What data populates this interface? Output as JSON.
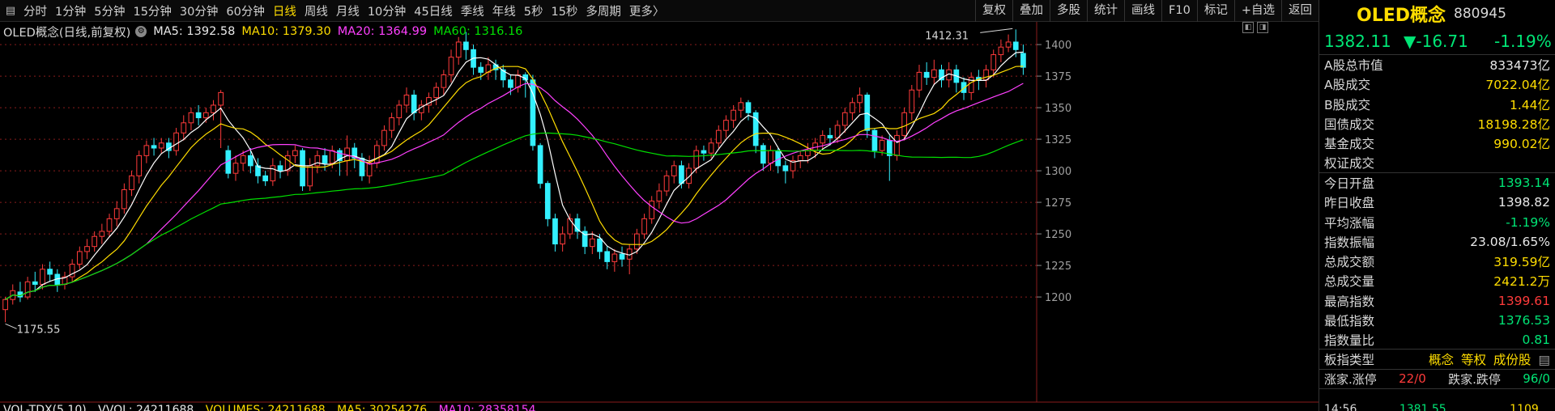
{
  "toolbar": {
    "periods": [
      "分时",
      "1分钟",
      "5分钟",
      "15分钟",
      "30分钟",
      "60分钟",
      "日线",
      "周线",
      "月线",
      "10分钟",
      "45日线",
      "季线",
      "年线",
      "5秒",
      "15秒",
      "多周期",
      "更多〉"
    ],
    "active_period": "日线",
    "tools": [
      "复权",
      "叠加",
      "多股",
      "统计",
      "画线",
      "F10",
      "标记",
      "+自选",
      "返回"
    ]
  },
  "legend": {
    "title": "OLED概念(日线,前复权)",
    "ma5": "MA5: 1392.58",
    "ma10": "MA10: 1379.30",
    "ma20": "MA20: 1364.99",
    "ma60": "MA60: 1316.16"
  },
  "colors": {
    "up": "#ff3b3b",
    "down": "#33f0ff",
    "ma5": "#ffffff",
    "ma10": "#ffdd00",
    "ma20": "#ff40ff",
    "ma60": "#00e000",
    "grid": "#8a1c1c"
  },
  "annotations": {
    "high_label": "1412.31",
    "low_label": "1175.55"
  },
  "volume_legend": {
    "label": "VOL-TDX(5,10)",
    "vvol": "VVOL: 24211688",
    "volumes": "VOLUMES: 24211688",
    "ma5": "MA5: 30254276",
    "ma10": "MA10: 28358154"
  },
  "panel": {
    "name": "OLED概念",
    "code": "880945",
    "price": "1382.11",
    "change": "▼-16.71",
    "change_pct": "-1.19%",
    "rows": [
      {
        "label": "A股总市值",
        "value": "833473亿",
        "color": "wht"
      },
      {
        "label": "A股成交",
        "value": "7022.04亿",
        "color": "yel"
      },
      {
        "label": "B股成交",
        "value": "1.44亿",
        "color": "yel"
      },
      {
        "label": "国债成交",
        "value": "18198.28亿",
        "color": "yel"
      },
      {
        "label": "基金成交",
        "value": "990.02亿",
        "color": "yel"
      },
      {
        "label": "权证成交",
        "value": "",
        "color": "yel"
      },
      {
        "label": "今日开盘",
        "value": "1393.14",
        "color": "grn"
      },
      {
        "label": "昨日收盘",
        "value": "1398.82",
        "color": "wht"
      },
      {
        "label": "平均涨幅",
        "value": "-1.19%",
        "color": "grn"
      },
      {
        "label": "指数振幅",
        "value": "23.08/1.65%",
        "color": "wht"
      },
      {
        "label": "总成交额",
        "value": "319.59亿",
        "color": "yel"
      },
      {
        "label": "总成交量",
        "value": "2421.2万",
        "color": "yel"
      },
      {
        "label": "最高指数",
        "value": "1399.61",
        "color": "red"
      },
      {
        "label": "最低指数",
        "value": "1376.53",
        "color": "grn"
      },
      {
        "label": "指数量比",
        "value": "0.81",
        "color": "grn"
      }
    ],
    "type_label": "板指类型",
    "type_values": [
      "概念",
      "等权",
      "成份股"
    ],
    "zd": {
      "up_label": "涨家.涨停",
      "up_value": "22/0",
      "down_label": "跌家.跌停",
      "down_value": "96/0"
    },
    "last_row": [
      "14:56",
      "1381.55",
      "1109"
    ]
  },
  "chart_data": {
    "type": "candlestick",
    "y_ticks": [
      1200,
      1225,
      1250,
      1275,
      1300,
      1325,
      1350,
      1375,
      1400
    ],
    "ylim": [
      1168,
      1418
    ],
    "grid": "horizontal dashed",
    "series": [
      {
        "name": "MA5"
      },
      {
        "name": "MA10"
      },
      {
        "name": "MA20"
      },
      {
        "name": "MA60"
      }
    ],
    "candles": [
      [
        1190,
        1198,
        1180,
        1200
      ],
      [
        1198,
        1205,
        1194,
        1210
      ],
      [
        1204,
        1200,
        1196,
        1212
      ],
      [
        1200,
        1212,
        1198,
        1216
      ],
      [
        1212,
        1210,
        1204,
        1220
      ],
      [
        1210,
        1222,
        1206,
        1226
      ],
      [
        1222,
        1218,
        1212,
        1228
      ],
      [
        1218,
        1210,
        1204,
        1222
      ],
      [
        1210,
        1216,
        1206,
        1220
      ],
      [
        1216,
        1226,
        1212,
        1230
      ],
      [
        1226,
        1236,
        1222,
        1240
      ],
      [
        1236,
        1240,
        1230,
        1246
      ],
      [
        1240,
        1248,
        1236,
        1252
      ],
      [
        1248,
        1252,
        1242,
        1258
      ],
      [
        1252,
        1262,
        1248,
        1266
      ],
      [
        1262,
        1270,
        1256,
        1276
      ],
      [
        1270,
        1285,
        1266,
        1290
      ],
      [
        1285,
        1296,
        1280,
        1300
      ],
      [
        1296,
        1312,
        1290,
        1316
      ],
      [
        1312,
        1320,
        1306,
        1324
      ],
      [
        1320,
        1318,
        1312,
        1326
      ],
      [
        1318,
        1322,
        1314,
        1326
      ],
      [
        1322,
        1316,
        1310,
        1326
      ],
      [
        1316,
        1330,
        1312,
        1334
      ],
      [
        1330,
        1338,
        1324,
        1344
      ],
      [
        1338,
        1346,
        1332,
        1350
      ],
      [
        1346,
        1342,
        1336,
        1352
      ],
      [
        1342,
        1346,
        1338,
        1350
      ],
      [
        1346,
        1352,
        1340,
        1356
      ],
      [
        1352,
        1362,
        1318,
        1364
      ],
      [
        1316,
        1298,
        1294,
        1320
      ],
      [
        1298,
        1306,
        1292,
        1312
      ],
      [
        1306,
        1312,
        1300,
        1316
      ],
      [
        1312,
        1304,
        1298,
        1318
      ],
      [
        1304,
        1296,
        1290,
        1310
      ],
      [
        1296,
        1292,
        1288,
        1300
      ],
      [
        1292,
        1304,
        1288,
        1310
      ],
      [
        1304,
        1300,
        1294,
        1308
      ],
      [
        1300,
        1312,
        1296,
        1316
      ],
      [
        1312,
        1316,
        1306,
        1320
      ],
      [
        1316,
        1288,
        1284,
        1318
      ],
      [
        1288,
        1304,
        1284,
        1310
      ],
      [
        1304,
        1312,
        1298,
        1316
      ],
      [
        1312,
        1306,
        1300,
        1318
      ],
      [
        1306,
        1316,
        1302,
        1320
      ],
      [
        1316,
        1308,
        1296,
        1318
      ],
      [
        1308,
        1318,
        1296,
        1328
      ],
      [
        1318,
        1310,
        1302,
        1322
      ],
      [
        1310,
        1296,
        1292,
        1314
      ],
      [
        1296,
        1306,
        1290,
        1312
      ],
      [
        1306,
        1320,
        1302,
        1324
      ],
      [
        1320,
        1332,
        1316,
        1336
      ],
      [
        1332,
        1342,
        1326,
        1346
      ],
      [
        1342,
        1352,
        1336,
        1356
      ],
      [
        1352,
        1360,
        1346,
        1366
      ],
      [
        1360,
        1346,
        1340,
        1364
      ],
      [
        1346,
        1352,
        1340,
        1356
      ],
      [
        1352,
        1358,
        1346,
        1362
      ],
      [
        1358,
        1366,
        1352,
        1370
      ],
      [
        1366,
        1376,
        1360,
        1380
      ],
      [
        1376,
        1390,
        1370,
        1396
      ],
      [
        1390,
        1402,
        1384,
        1406
      ],
      [
        1402,
        1396,
        1388,
        1410
      ],
      [
        1396,
        1382,
        1376,
        1400
      ],
      [
        1382,
        1378,
        1372,
        1386
      ],
      [
        1378,
        1384,
        1372,
        1390
      ],
      [
        1384,
        1380,
        1372,
        1388
      ],
      [
        1380,
        1372,
        1366,
        1384
      ],
      [
        1372,
        1366,
        1360,
        1376
      ],
      [
        1366,
        1376,
        1362,
        1380
      ],
      [
        1376,
        1372,
        1358,
        1378
      ],
      [
        1372,
        1320,
        1316,
        1376
      ],
      [
        1320,
        1290,
        1286,
        1322
      ],
      [
        1290,
        1262,
        1256,
        1292
      ],
      [
        1262,
        1242,
        1236,
        1266
      ],
      [
        1242,
        1250,
        1236,
        1256
      ],
      [
        1250,
        1262,
        1246,
        1266
      ],
      [
        1262,
        1252,
        1246,
        1266
      ],
      [
        1252,
        1240,
        1234,
        1256
      ],
      [
        1240,
        1246,
        1234,
        1252
      ],
      [
        1246,
        1236,
        1230,
        1250
      ],
      [
        1236,
        1228,
        1222,
        1240
      ],
      [
        1228,
        1234,
        1220,
        1238
      ],
      [
        1234,
        1230,
        1224,
        1240
      ],
      [
        1230,
        1238,
        1218,
        1242
      ],
      [
        1238,
        1250,
        1234,
        1254
      ],
      [
        1250,
        1262,
        1246,
        1266
      ],
      [
        1262,
        1276,
        1258,
        1280
      ],
      [
        1276,
        1284,
        1270,
        1290
      ],
      [
        1284,
        1296,
        1280,
        1300
      ],
      [
        1296,
        1304,
        1290,
        1308
      ],
      [
        1304,
        1290,
        1286,
        1308
      ],
      [
        1290,
        1302,
        1286,
        1306
      ],
      [
        1302,
        1316,
        1298,
        1320
      ],
      [
        1316,
        1314,
        1308,
        1320
      ],
      [
        1314,
        1322,
        1310,
        1326
      ],
      [
        1322,
        1332,
        1318,
        1336
      ],
      [
        1332,
        1340,
        1326,
        1344
      ],
      [
        1340,
        1348,
        1334,
        1352
      ],
      [
        1348,
        1354,
        1342,
        1358
      ],
      [
        1354,
        1346,
        1340,
        1356
      ],
      [
        1346,
        1320,
        1314,
        1348
      ],
      [
        1320,
        1306,
        1300,
        1322
      ],
      [
        1306,
        1316,
        1300,
        1320
      ],
      [
        1316,
        1304,
        1298,
        1318
      ],
      [
        1304,
        1300,
        1290,
        1308
      ],
      [
        1300,
        1308,
        1294,
        1312
      ],
      [
        1308,
        1312,
        1302,
        1316
      ],
      [
        1312,
        1316,
        1306,
        1322
      ],
      [
        1316,
        1322,
        1310,
        1326
      ],
      [
        1322,
        1328,
        1316,
        1332
      ],
      [
        1328,
        1326,
        1320,
        1334
      ],
      [
        1326,
        1336,
        1322,
        1340
      ],
      [
        1336,
        1346,
        1330,
        1350
      ],
      [
        1346,
        1354,
        1340,
        1358
      ],
      [
        1354,
        1360,
        1346,
        1366
      ],
      [
        1360,
        1332,
        1326,
        1362
      ],
      [
        1332,
        1316,
        1310,
        1334
      ],
      [
        1316,
        1324,
        1312,
        1328
      ],
      [
        1324,
        1312,
        1292,
        1328
      ],
      [
        1312,
        1328,
        1308,
        1332
      ],
      [
        1328,
        1346,
        1324,
        1350
      ],
      [
        1346,
        1364,
        1340,
        1368
      ],
      [
        1364,
        1378,
        1358,
        1384
      ],
      [
        1378,
        1374,
        1368,
        1386
      ],
      [
        1374,
        1380,
        1368,
        1388
      ],
      [
        1380,
        1372,
        1366,
        1384
      ],
      [
        1372,
        1380,
        1366,
        1386
      ],
      [
        1380,
        1370,
        1362,
        1384
      ],
      [
        1370,
        1362,
        1356,
        1374
      ],
      [
        1362,
        1374,
        1356,
        1378
      ],
      [
        1374,
        1372,
        1364,
        1380
      ],
      [
        1372,
        1380,
        1366,
        1384
      ],
      [
        1380,
        1392,
        1374,
        1396
      ],
      [
        1392,
        1398,
        1386,
        1404
      ],
      [
        1398,
        1402,
        1394,
        1408
      ],
      [
        1402,
        1396,
        1390,
        1412
      ],
      [
        1393,
        1382,
        1376,
        1400
      ]
    ]
  }
}
